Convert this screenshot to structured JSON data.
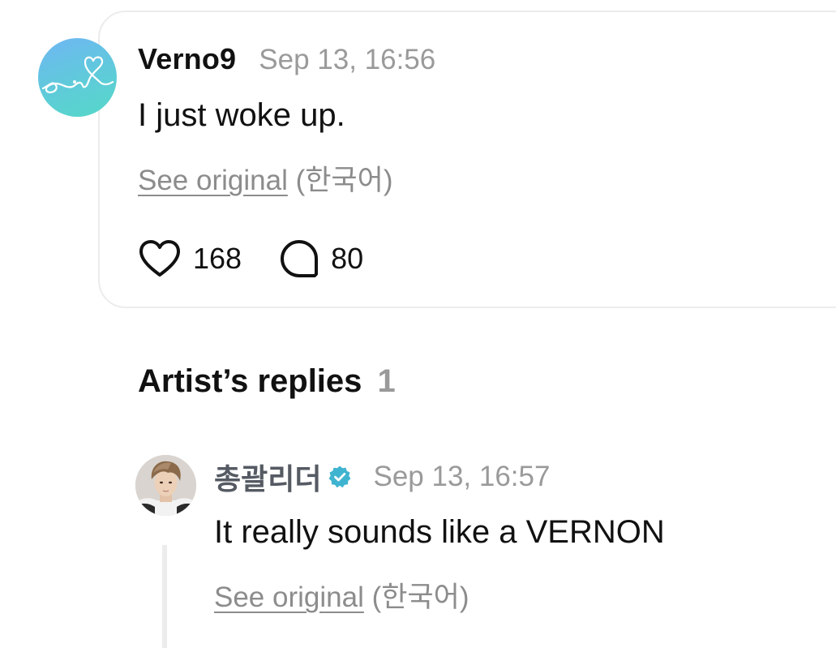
{
  "post": {
    "author": "Verno9",
    "timestamp": "Sep 13, 16:56",
    "body": "I just woke up.",
    "see_original": "See original",
    "original_language": "(한국어)",
    "like_count": "168",
    "comment_count": "80",
    "avatar_icon": "heart-doodle-avatar",
    "avatar_gradient": [
      "#6fb6f4",
      "#55d8c8"
    ]
  },
  "artist_replies": {
    "title": "Artist’s replies",
    "count": "1",
    "items": [
      {
        "author": "총괄리더",
        "verified": true,
        "verified_color": "#3fb4d0",
        "timestamp": "Sep 13, 16:57",
        "body": "It really sounds like a VERNON",
        "see_original": "See original",
        "original_language": "(한국어)"
      }
    ]
  },
  "colors": {
    "text_primary": "#111111",
    "text_muted": "#9a9a9a",
    "border": "#ececec",
    "artist_name": "#555a63"
  },
  "icons": [
    "heart-icon",
    "comment-bubble-icon",
    "verified-badge-icon"
  ]
}
